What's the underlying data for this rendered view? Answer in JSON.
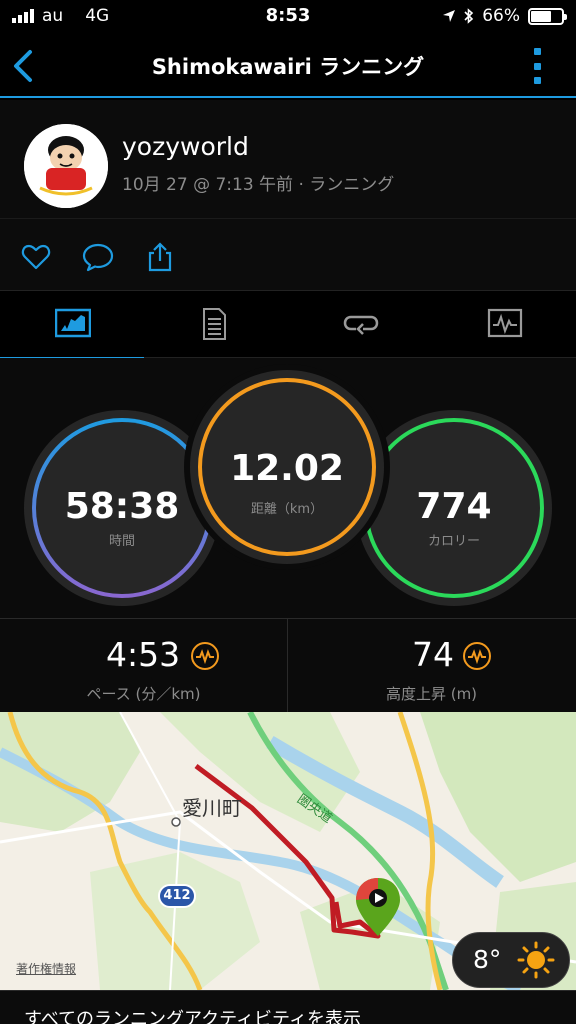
{
  "status_bar": {
    "carrier": "au",
    "network": "4G",
    "time": "8:53",
    "battery": "66%",
    "battery_level": 0.66
  },
  "nav": {
    "title": "Shimokawairi ランニング"
  },
  "profile": {
    "username": "yozyworld",
    "meta": "10月 27 @ 7:13 午前 · ランニング"
  },
  "stats": {
    "time": {
      "value": "58:38",
      "label": "時間"
    },
    "distance": {
      "value": "12.02",
      "label": "距離（km）"
    },
    "calories": {
      "value": "774",
      "label": "カロリー"
    }
  },
  "substats": {
    "pace": {
      "value": "4:53",
      "label": "ペース (分／km)"
    },
    "elevation": {
      "value": "74",
      "label": "高度上昇 (m)"
    }
  },
  "map": {
    "town_label": "愛川町",
    "route_badge": "412",
    "expressway_label": "圏央道",
    "credit": "著作権情報",
    "temperature": "8°"
  },
  "footer": {
    "link_text": "すべてのランニングアクティビティを表示"
  },
  "colors": {
    "accent": "#1e9be0",
    "time_ring_a": "#1e9be0",
    "time_ring_b": "#8a67d0",
    "distance_ring": "#f39a1e",
    "calories_ring": "#2bd95a",
    "route": "#c01c24",
    "marker": "#5aa51c"
  }
}
